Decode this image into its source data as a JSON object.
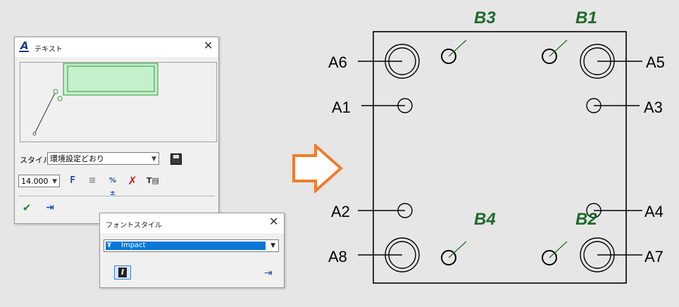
{
  "text_dialog": {
    "title": "テキスト",
    "close_glyph": "✕",
    "style_label": "スタイル:",
    "style_value": "環境設定どおり",
    "font_size_value": "14.000",
    "toolbar_icons": [
      "bold-F-icon",
      "paragraph-icon",
      "special-char-icon",
      "delete-x-icon",
      "text-edit-icon"
    ],
    "bottom_icons": [
      "ok-check-icon",
      "exit-door-icon"
    ]
  },
  "font_style_dialog": {
    "title": "フォントスタイル",
    "close_glyph": "✕",
    "font_value": "Impact",
    "italic_glyph": "I"
  },
  "drawing": {
    "a_labels": {
      "a6": "A6",
      "a1": "A1",
      "a2": "A2",
      "a8": "A8",
      "a5": "A5",
      "a3": "A3",
      "a4": "A4",
      "a7": "A7"
    },
    "b_labels": {
      "b3": "B3",
      "b1": "B1",
      "b4": "B4",
      "b2": "B2"
    },
    "b_color": "#1e6a2a",
    "line_color": "#000000"
  },
  "arrow_color": "#f07c2a"
}
